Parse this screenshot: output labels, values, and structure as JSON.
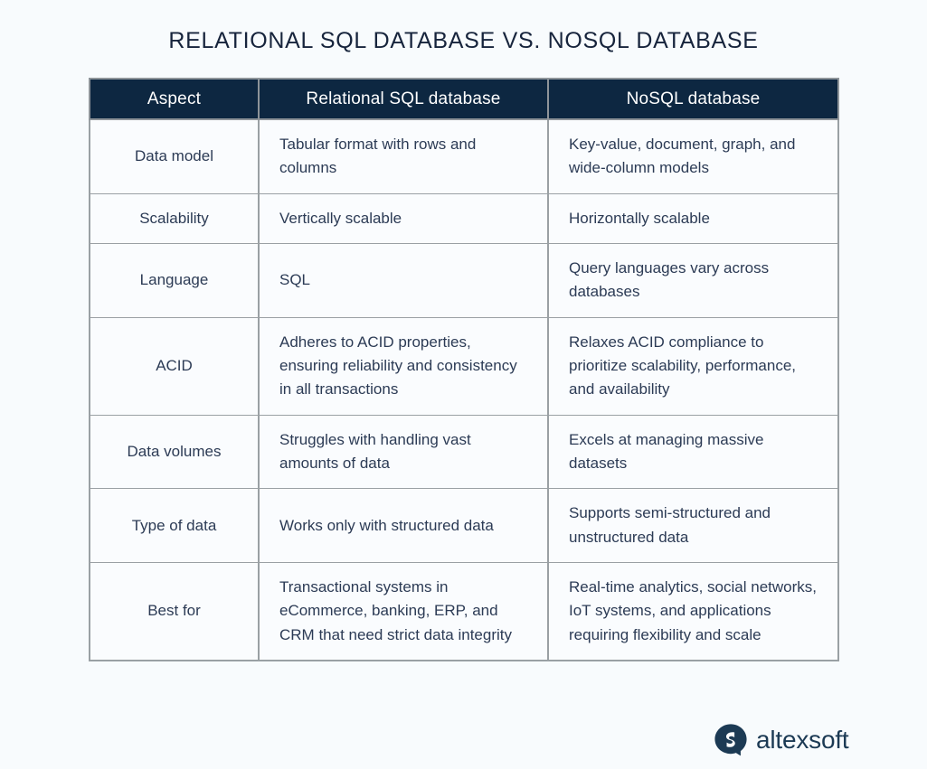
{
  "title": "RELATIONAL SQL DATABASE VS. NOSQL DATABASE",
  "colors": {
    "header_bg": "#0d2741",
    "header_text": "#ffffff",
    "page_bg": "#f8fbfd",
    "cell_bg": "#fafcfe",
    "cell_text": "#2c3b55",
    "title_text": "#17243c",
    "border": "#9aa0a4",
    "brand": "#1c3a54"
  },
  "table": {
    "columns": [
      {
        "label": "Aspect"
      },
      {
        "label": "Relational SQL database"
      },
      {
        "label": "NoSQL database"
      }
    ],
    "rows": [
      {
        "aspect": "Data model",
        "sql": "Tabular format with rows and columns",
        "nosql": "Key-value, document, graph, and wide-column models"
      },
      {
        "aspect": "Scalability",
        "sql": "Vertically scalable",
        "nosql": "Horizontally scalable"
      },
      {
        "aspect": "Language",
        "sql": "SQL",
        "nosql": "Query languages vary across databases"
      },
      {
        "aspect": "ACID",
        "sql": "Adheres to ACID properties, ensuring reliability and consistency in all transactions",
        "nosql": "Relaxes ACID compliance to prioritize scalability, performance, and availability"
      },
      {
        "aspect": "Data volumes",
        "sql": "Struggles with handling vast amounts of data",
        "nosql": "Excels at managing massive datasets"
      },
      {
        "aspect": "Type of data",
        "sql": "Works only with structured data",
        "nosql": "Supports semi-structured and unstructured data"
      },
      {
        "aspect": "Best for",
        "sql": "Transactional systems in eCommerce, banking, ERP, and CRM that need strict data integrity",
        "nosql": "Real-time analytics, social networks, IoT systems, and applications requiring flexibility and scale"
      }
    ]
  },
  "footer": {
    "logo_icon": "altexsoft-speech-bubble-icon",
    "brand_name": "altexsoft"
  }
}
